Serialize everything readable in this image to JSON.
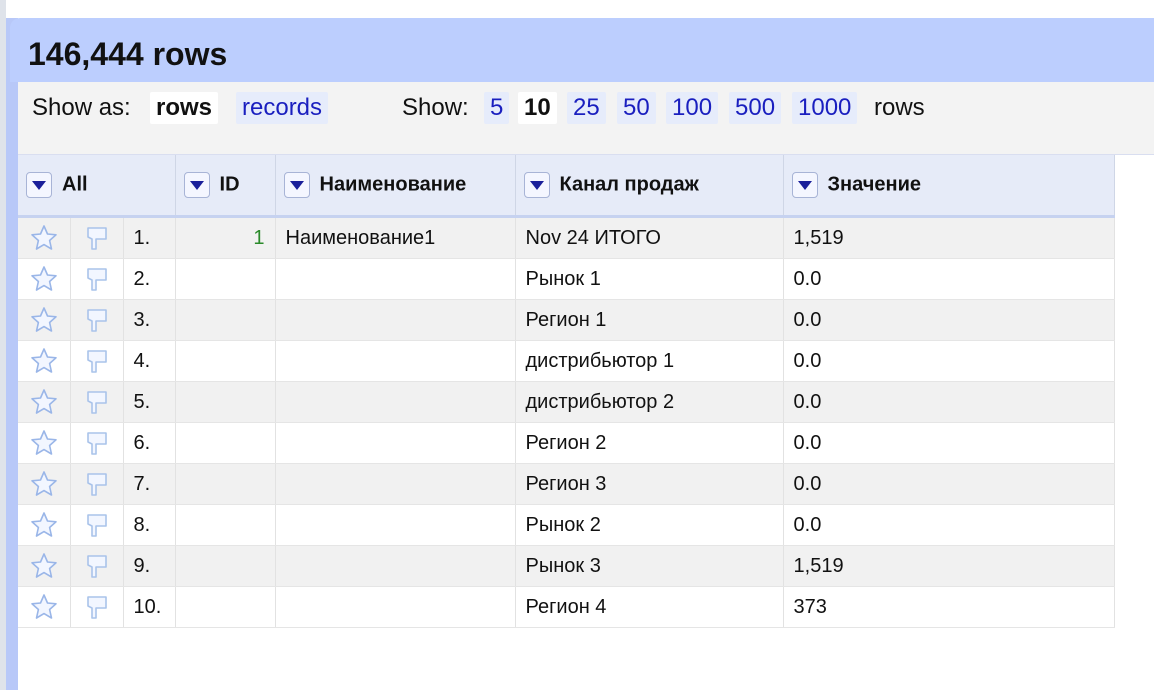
{
  "header": {
    "row_count": "146,444 rows"
  },
  "controls": {
    "show_as_label": "Show as:",
    "show_as_options": [
      "rows",
      "records"
    ],
    "show_as_selected": "rows",
    "show_label": "Show:",
    "page_size_options": [
      "5",
      "10",
      "25",
      "50",
      "100",
      "500",
      "1000"
    ],
    "page_size_selected": "10",
    "rows_suffix": "rows"
  },
  "columns": [
    "All",
    "ID",
    "Наименование",
    "Канал продаж",
    "Значение"
  ],
  "rows": [
    {
      "n": "1.",
      "id": "1",
      "name": "Наименование1",
      "channel": "Nov 24 ИТОГО",
      "value": "1,519"
    },
    {
      "n": "2.",
      "id": "",
      "name": "",
      "channel": "Рынок 1",
      "value": "0.0"
    },
    {
      "n": "3.",
      "id": "",
      "name": "",
      "channel": "Регион 1",
      "value": "0.0"
    },
    {
      "n": "4.",
      "id": "",
      "name": "",
      "channel": "дистрибьютор 1",
      "value": "0.0"
    },
    {
      "n": "5.",
      "id": "",
      "name": "",
      "channel": "дистрибьютор 2",
      "value": "0.0"
    },
    {
      "n": "6.",
      "id": "",
      "name": "",
      "channel": "Регион 2",
      "value": "0.0"
    },
    {
      "n": "7.",
      "id": "",
      "name": "",
      "channel": "Регион 3",
      "value": "0.0"
    },
    {
      "n": "8.",
      "id": "",
      "name": "",
      "channel": "Рынок 2",
      "value": "0.0"
    },
    {
      "n": "9.",
      "id": "",
      "name": "",
      "channel": "Рынок 3",
      "value": "1,519"
    },
    {
      "n": "10.",
      "id": "",
      "name": "",
      "channel": "Регион 4",
      "value": "373"
    }
  ],
  "colors": {
    "header_bg": "#bccefe",
    "link": "#1a1fbf",
    "id_value": "#2a8a2a"
  },
  "icons": [
    "star-icon",
    "flag-icon",
    "dropdown-arrow-icon"
  ]
}
